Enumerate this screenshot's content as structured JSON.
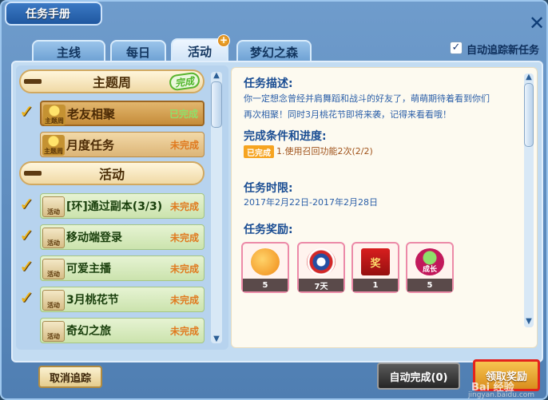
{
  "window": {
    "title": "任务手册",
    "close_symbol": "✕",
    "auto_track_label": "自动追踪新任务",
    "auto_track_checked": true
  },
  "tabs": [
    {
      "label": "主线",
      "active": false
    },
    {
      "label": "每日",
      "active": false
    },
    {
      "label": "活动",
      "active": true,
      "badge": "+"
    },
    {
      "label": "梦幻之森",
      "active": false
    }
  ],
  "quest_list": {
    "groups": [
      {
        "title": "主题周",
        "badge": "完成",
        "items": [
          {
            "icon_label": "主题周",
            "name": "老友相聚",
            "status": "已完成",
            "tracked": true,
            "selected": true
          },
          {
            "icon_label": "主题周",
            "name": "月度任务",
            "status": "未完成",
            "tracked": false,
            "selected": false
          }
        ]
      },
      {
        "title": "活动",
        "items": [
          {
            "icon_label": "活动",
            "name": "[环]通过副本(3/3)",
            "status": "未完成",
            "tracked": true
          },
          {
            "icon_label": "活动",
            "name": "移动端登录",
            "status": "未完成",
            "tracked": true
          },
          {
            "icon_label": "活动",
            "name": "可爱主播",
            "status": "未完成",
            "tracked": true
          },
          {
            "icon_label": "活动",
            "name": "3月桃花节",
            "status": "未完成",
            "tracked": true
          },
          {
            "icon_label": "活动",
            "name": "奇幻之旅",
            "status": "未完成",
            "tracked": false
          }
        ]
      }
    ]
  },
  "detail": {
    "desc_title": "任务描述:",
    "desc_line1": "你一定想念曾经并肩舞蹈和战斗的好友了，萌萌期待着看到你们",
    "desc_line2": "再次相聚！同时3月桃花节即将来袭，记得来看看哦！",
    "cond_title": "完成条件和进度:",
    "cond_badge": "已完成",
    "cond_text": "1.使用召回功能2次(2/2)",
    "time_title": "任务时限:",
    "time_text": "2017年2月22日-2017年2月28日",
    "reward_title": "任务奖励:",
    "rewards": [
      {
        "icon": "orange-fruit-icon",
        "count": "5"
      },
      {
        "icon": "shield-badge-icon",
        "count": "7天"
      },
      {
        "icon": "red-envelope-icon",
        "count": "1"
      },
      {
        "icon": "growth-potion-icon",
        "count": "5",
        "label": "成长"
      }
    ],
    "reward3_label": "奖"
  },
  "buttons": {
    "cancel_track": "取消追踪",
    "auto_complete": "自动完成(0)",
    "claim_reward": "领取奖励"
  },
  "watermark": {
    "text": "Bai 经验",
    "sub": "jingyan.baidu.com"
  },
  "colors": {
    "done_green": "#5cb530",
    "undone_orange": "#e07a1f",
    "claim_highlight": "#e4231d"
  }
}
